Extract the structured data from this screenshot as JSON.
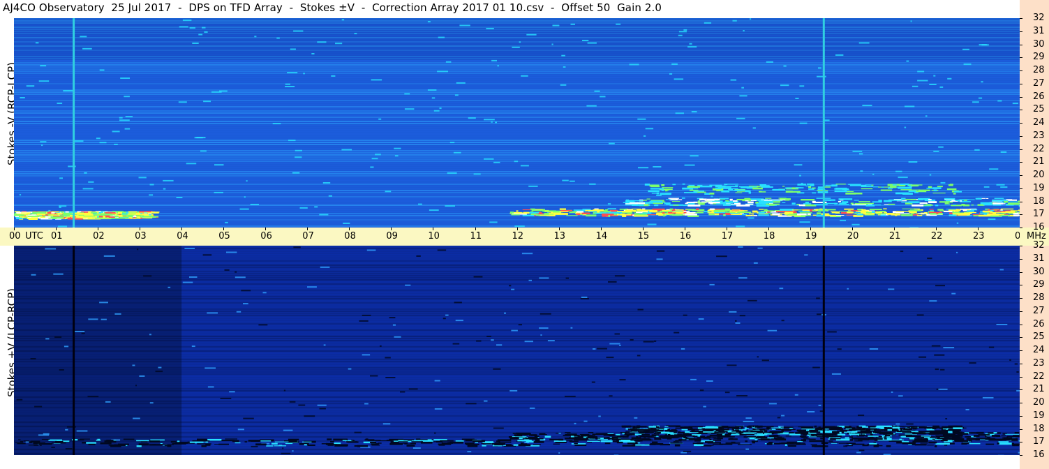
{
  "header": {
    "title": "AJ4CO Observatory  25 Jul 2017  -  DPS on TFD Array  -  Stokes ±V  -  Correction Array 2017 01 10.csv  -  Offset 50  Gain 2.0"
  },
  "chart_data": [
    {
      "type": "heatmap",
      "ylabel": "Stokes -V (RCP-LCP)",
      "x_range_hours": [
        0,
        24
      ],
      "ylim_mhz": [
        16,
        32
      ],
      "y_ticks": [
        "32",
        "31",
        "30",
        "29",
        "28",
        "27",
        "26",
        "25",
        "24",
        "23",
        "22",
        "21",
        "20",
        "19",
        "18",
        "17",
        "16"
      ],
      "background_color": "#1a5ad6",
      "colormap": [
        "#0a1a7a",
        "#1f5fe0",
        "#2fa0ff",
        "#28e0ff",
        "#7dff6a",
        "#ffff40",
        "#ff5050",
        "#ffffff"
      ],
      "vertical_lines": [
        {
          "hour": 1.4,
          "color": "#30d0e0"
        },
        {
          "hour": 19.3,
          "color": "#30d0e0"
        }
      ],
      "activity": [
        {
          "start_hour": 0.0,
          "end_hour": 3.2,
          "mhz": 17.0,
          "level": "high"
        },
        {
          "start_hour": 11.8,
          "end_hour": 24.0,
          "mhz": 17.2,
          "level": "high"
        },
        {
          "start_hour": 14.5,
          "end_hour": 24.0,
          "mhz": 18.0,
          "level": "medium"
        },
        {
          "start_hour": 15.0,
          "end_hour": 22.5,
          "mhz": 19.0,
          "level": "low"
        }
      ]
    },
    {
      "type": "heatmap",
      "ylabel": "Stokes +V (LCP-RCP)",
      "x_range_hours": [
        0,
        24
      ],
      "ylim_mhz": [
        16,
        32
      ],
      "y_ticks": [
        "32",
        "31",
        "30",
        "29",
        "28",
        "27",
        "26",
        "25",
        "24",
        "23",
        "22",
        "21",
        "20",
        "19",
        "18",
        "17",
        "16"
      ],
      "background_color": "#0b2a9a",
      "colormap": [
        "#000820",
        "#061a6a",
        "#0c2fb0",
        "#1f60e0",
        "#2fa0ff",
        "#28e0ff"
      ],
      "vertical_lines": [
        {
          "hour": 1.4,
          "color": "#000010"
        },
        {
          "hour": 19.3,
          "color": "#000010"
        }
      ],
      "activity": [
        {
          "start_hour": 0.0,
          "end_hour": 24.0,
          "mhz": 17.0,
          "level": "dark"
        },
        {
          "start_hour": 11.8,
          "end_hour": 24.0,
          "mhz": 17.5,
          "level": "dark"
        },
        {
          "start_hour": 14.5,
          "end_hour": 22.5,
          "mhz": 18.0,
          "level": "dark"
        }
      ]
    }
  ],
  "time_axis": {
    "labels": [
      "00",
      "01",
      "02",
      "03",
      "04",
      "05",
      "06",
      "07",
      "08",
      "09",
      "10",
      "11",
      "12",
      "13",
      "14",
      "15",
      "16",
      "17",
      "18",
      "19",
      "20",
      "21",
      "22",
      "23",
      "00"
    ],
    "utc_label": "UTC",
    "unit_label": "MHz"
  }
}
